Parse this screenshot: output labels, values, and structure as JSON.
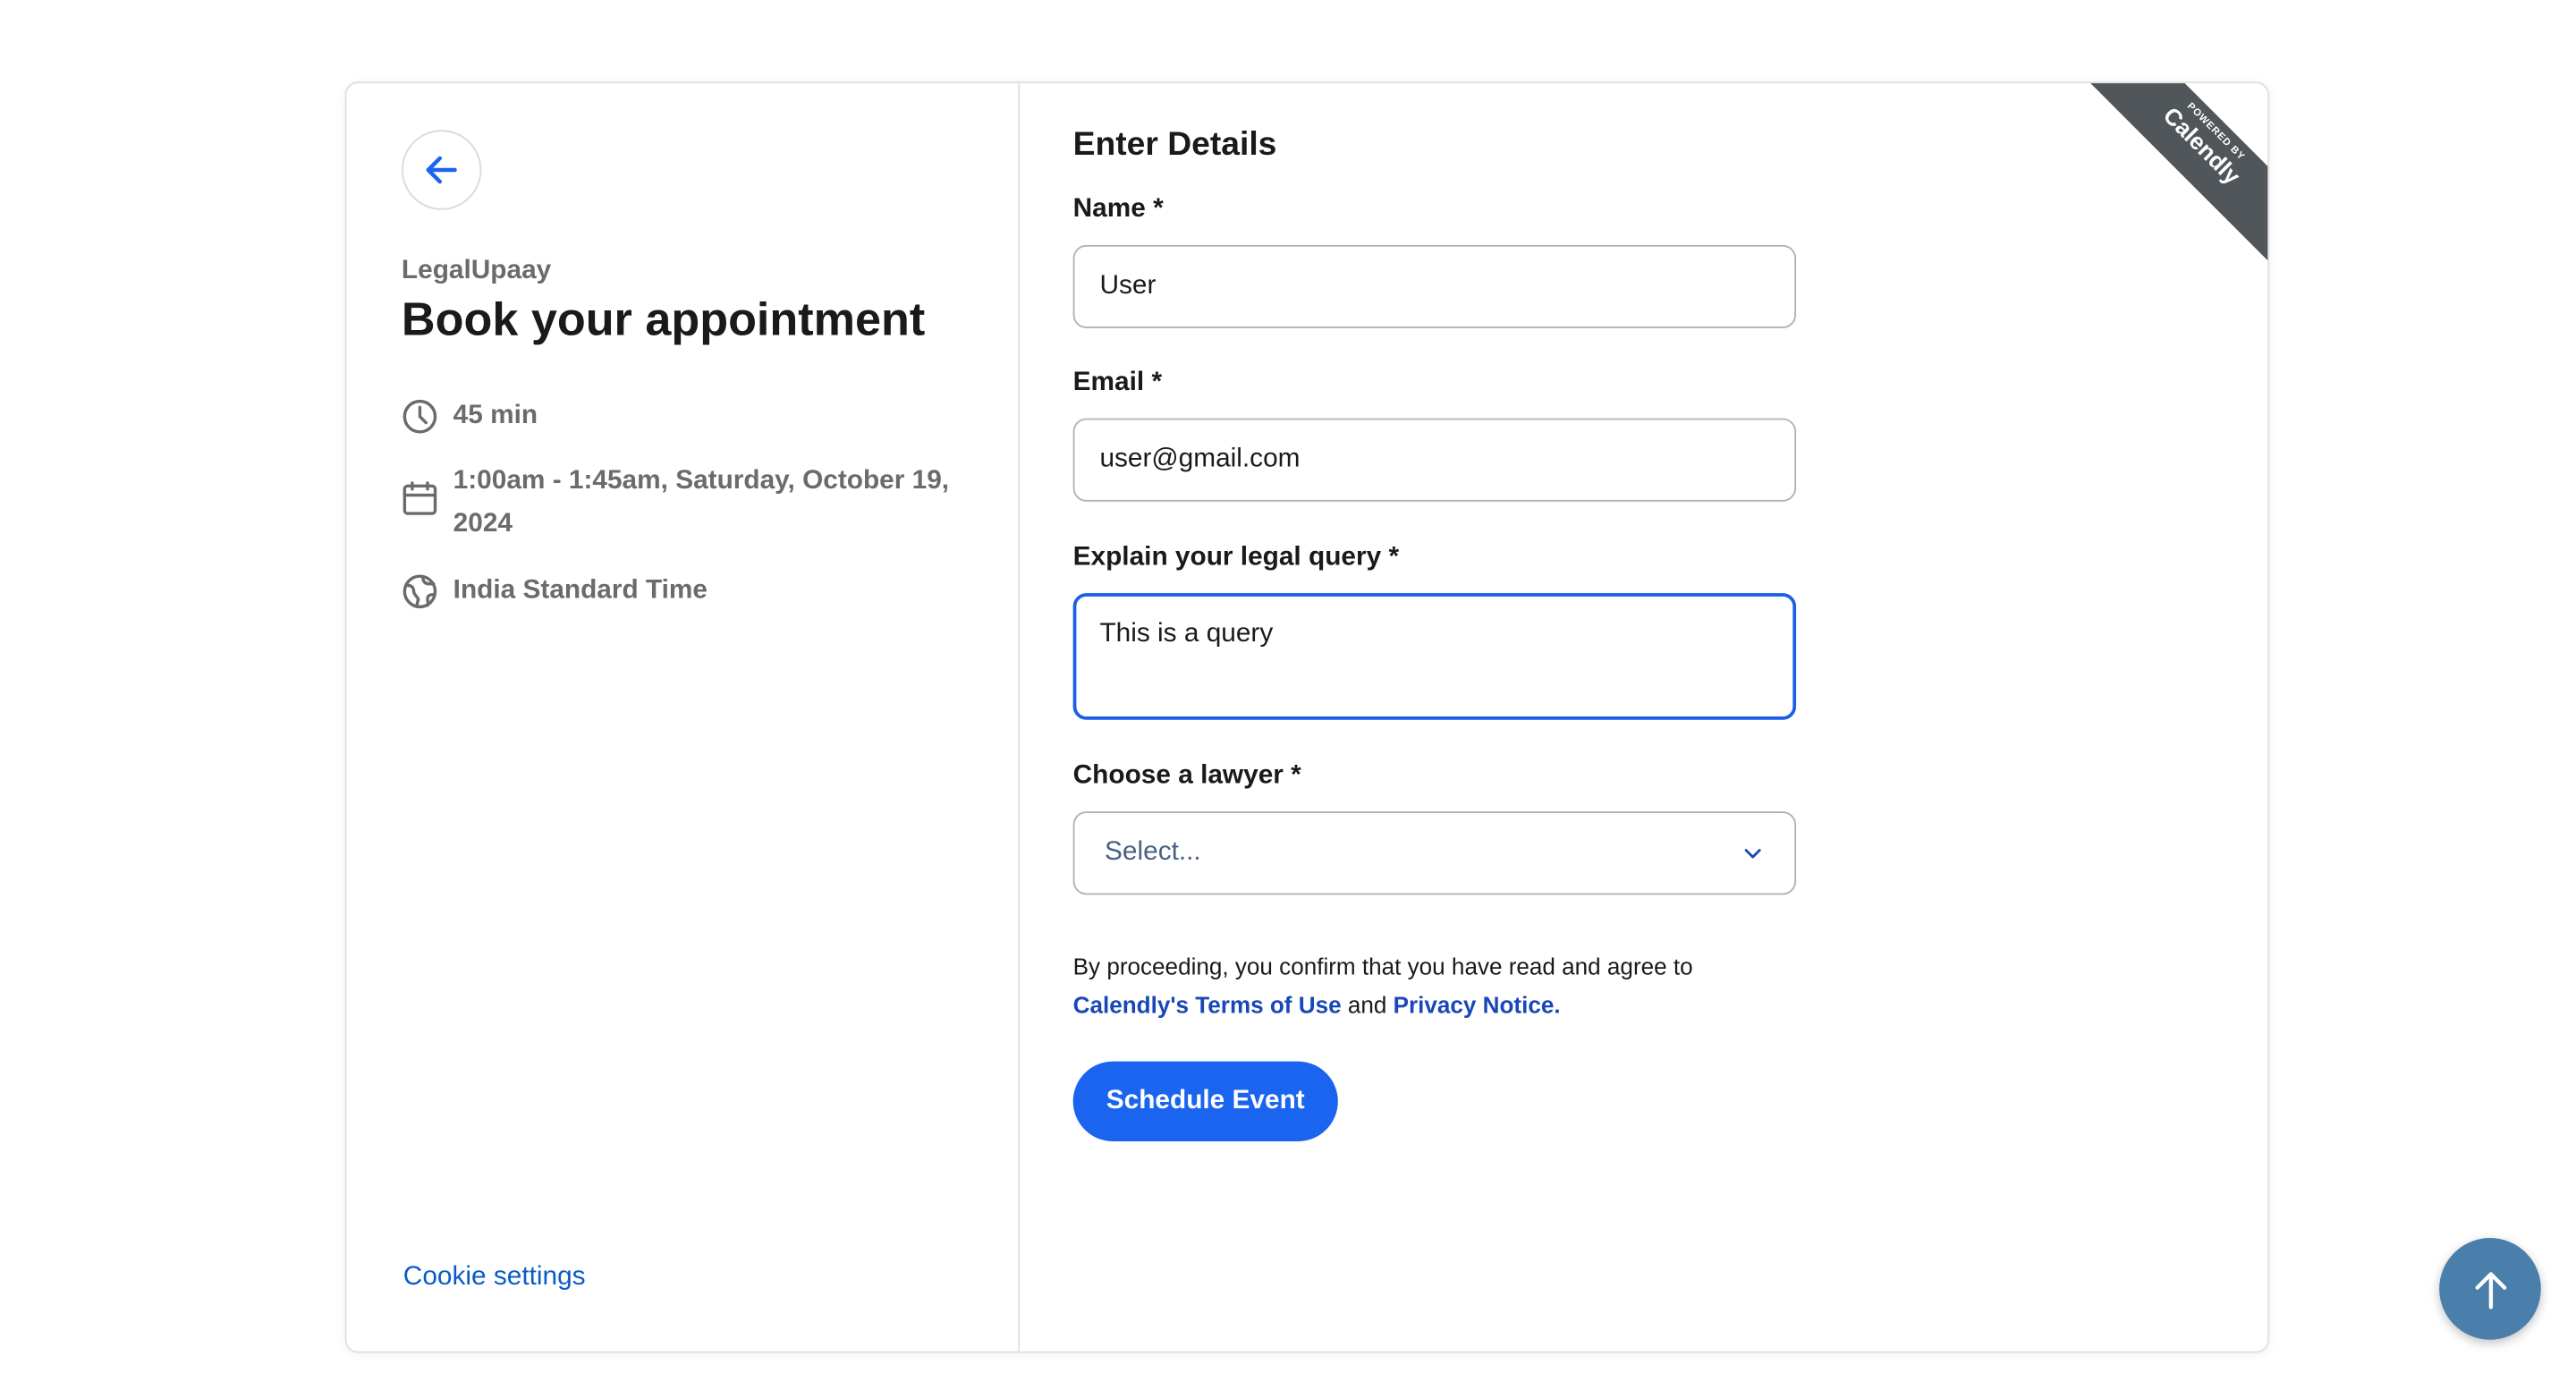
{
  "sidebar": {
    "org_name": "LegalUpaay",
    "title": "Book your appointment",
    "duration": "45 min",
    "datetime": "1:00am - 1:45am, Saturday, October 19, 2024",
    "timezone": "India Standard Time",
    "cookie_settings": "Cookie settings",
    "icons": [
      "back-arrow-icon",
      "clock-icon",
      "calendar-icon",
      "globe-icon"
    ]
  },
  "form": {
    "title": "Enter Details",
    "name_label": "Name *",
    "name_value": "User",
    "email_label": "Email *",
    "email_value": "user@gmail.com",
    "query_label": "Explain your legal query *",
    "query_value": "This is a query",
    "lawyer_label": "Choose a lawyer *",
    "lawyer_placeholder": "Select...",
    "consent_text": "By proceeding, you confirm that you have read and agree to",
    "terms_link": "Calendly's Terms of Use",
    "consent_and": "and",
    "privacy_link": "Privacy Notice.",
    "submit_label": "Schedule Event"
  },
  "ribbon": {
    "small": "POWERED BY",
    "big": "Calendly"
  },
  "colors": {
    "accent": "#1a64f0",
    "link": "#1a47b8",
    "focus_border": "#1a5de8",
    "fab": "#4a7fac",
    "ribbon": "#505659"
  }
}
